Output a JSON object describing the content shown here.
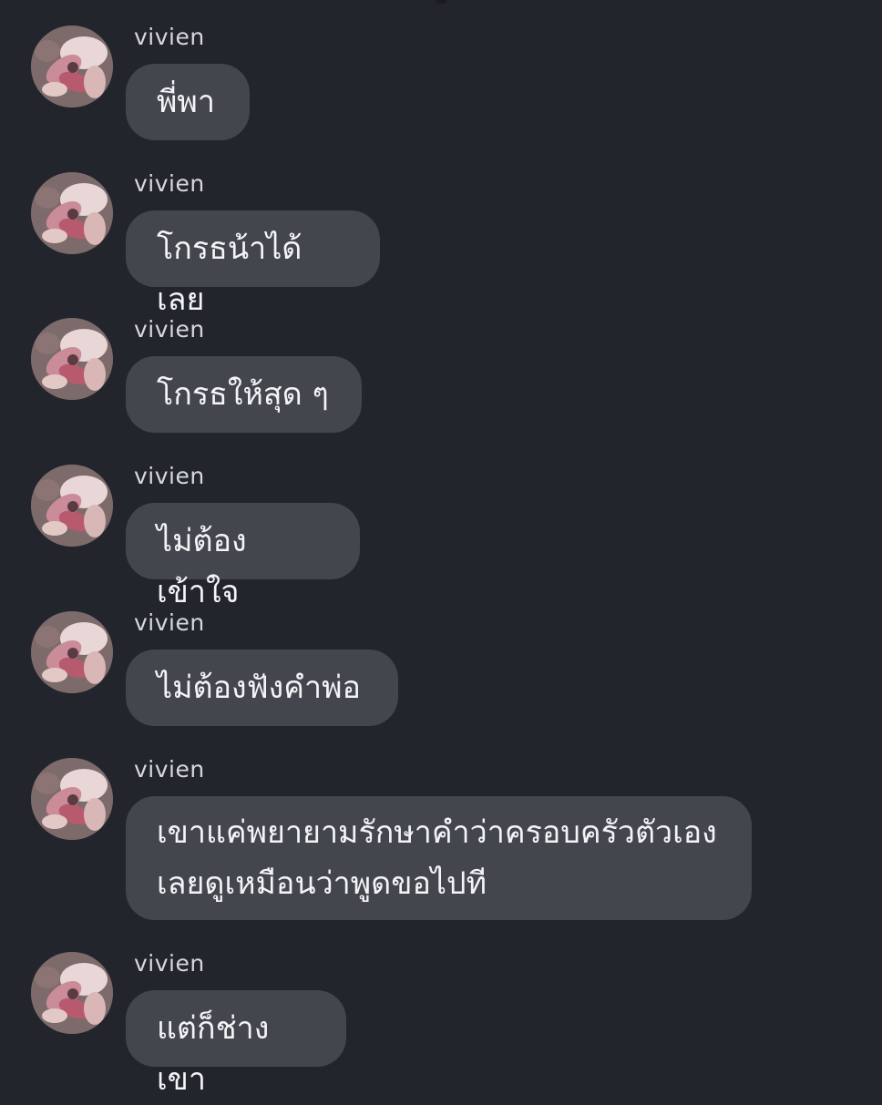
{
  "sender_name": "vivien",
  "messages": [
    {
      "text": "พี่พา"
    },
    {
      "text": "โกรธน้าได้เลย"
    },
    {
      "text": "โกรธให้สุด ๆ"
    },
    {
      "text": "ไม่ต้องเข้าใจ"
    },
    {
      "text": "ไม่ต้องฟังคำพ่อ"
    },
    {
      "text": "เขาแค่พยายามรักษาคำว่าครอบครัวตัวเอง\nเลยดูเหมือนว่าพูดขอไปที"
    },
    {
      "text": "แต่ก็ช่างเขา"
    }
  ],
  "colors": {
    "background": "#22252c",
    "bubble": "#43464d",
    "text": "#f3f4f6",
    "sender": "#d6d8dc"
  },
  "avatar_icon": "flower-avatar-icon"
}
